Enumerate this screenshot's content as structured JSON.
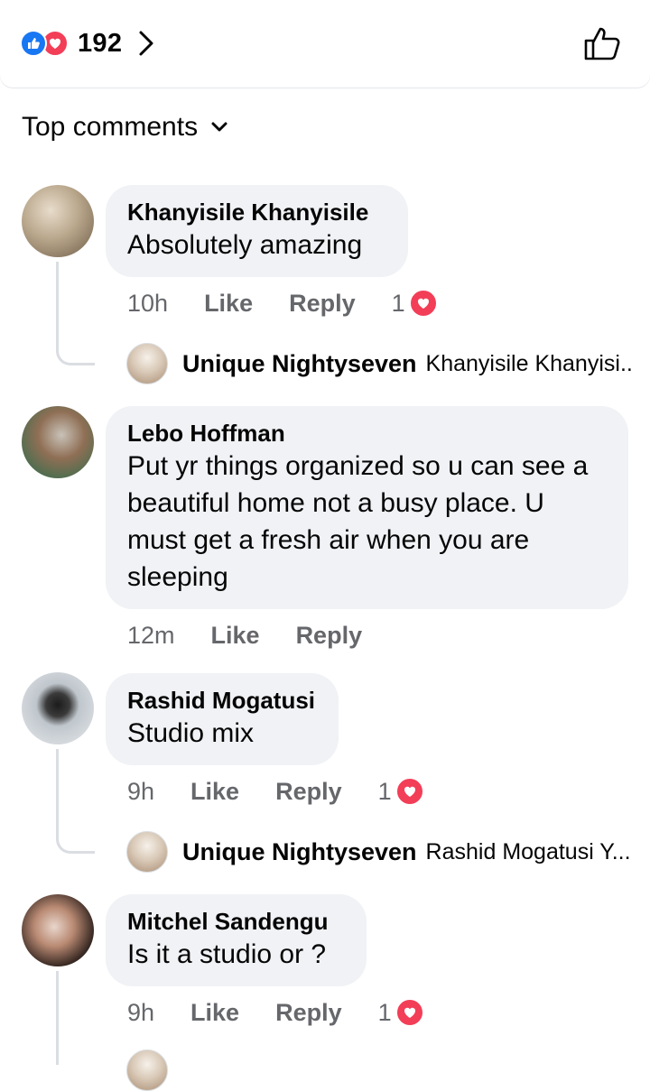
{
  "reactions": {
    "count": "192",
    "types": [
      "like-icon",
      "love-icon"
    ]
  },
  "sort_label": "Top comments",
  "comments": [
    {
      "name": "Khanyisile Khanyisile",
      "text": "Absolutely amazing",
      "time": "10h",
      "like": "Like",
      "reply": "Reply",
      "reaction_count": "1",
      "reply_preview": {
        "name": "Unique Nightyseven",
        "text": "Khanyisile Khanyisi..."
      }
    },
    {
      "name": "Lebo Hoffman",
      "text": "Put yr things organized so u can see a beautiful home not a busy place. U must get a fresh air when you are sleeping",
      "time": "12m",
      "like": "Like",
      "reply": "Reply"
    },
    {
      "name": "Rashid Mogatusi",
      "text": "Studio mix",
      "time": "9h",
      "like": "Like",
      "reply": "Reply",
      "reaction_count": "1",
      "reply_preview": {
        "name": "Unique Nightyseven",
        "text": "Rashid Mogatusi Y..."
      }
    },
    {
      "name": "Mitchel Sandengu",
      "text": "Is it a studio or ?",
      "time": "9h",
      "like": "Like",
      "reply": "Reply",
      "reaction_count": "1"
    }
  ],
  "colors": {
    "like_blue": "#1877f2",
    "love_red": "#f33e58",
    "bubble_bg": "#f0f2f5",
    "meta_gray": "#65676b"
  }
}
